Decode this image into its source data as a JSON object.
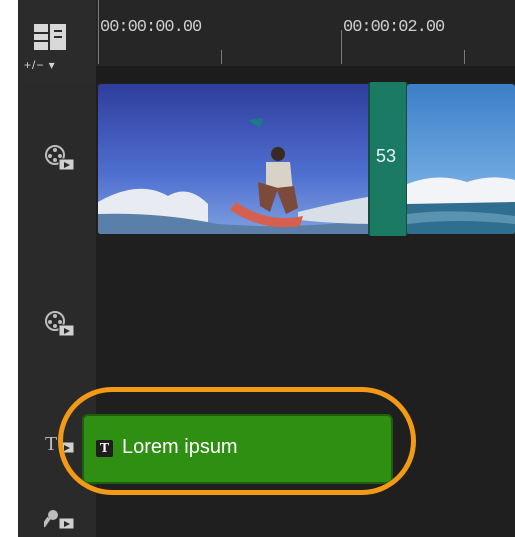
{
  "ruler": {
    "timecode_start": "00:00:00.00",
    "timecode_mid": "00:00:02.00"
  },
  "toolbar": {
    "zoom_label": "+/−  ▾"
  },
  "tracks": {
    "video_track_icon": "video-track-icon",
    "overlay_track_icon": "overlay-track-icon",
    "title_track_icon": "title-track-icon",
    "voice_track_icon": "voice-track-icon"
  },
  "video_track": {
    "transition_label": "53"
  },
  "title_track": {
    "clip_label": "Lorem ipsum"
  },
  "colors": {
    "transition": "#1b7a64",
    "title_clip": "#2f8f12",
    "highlight": "#f29a16"
  }
}
